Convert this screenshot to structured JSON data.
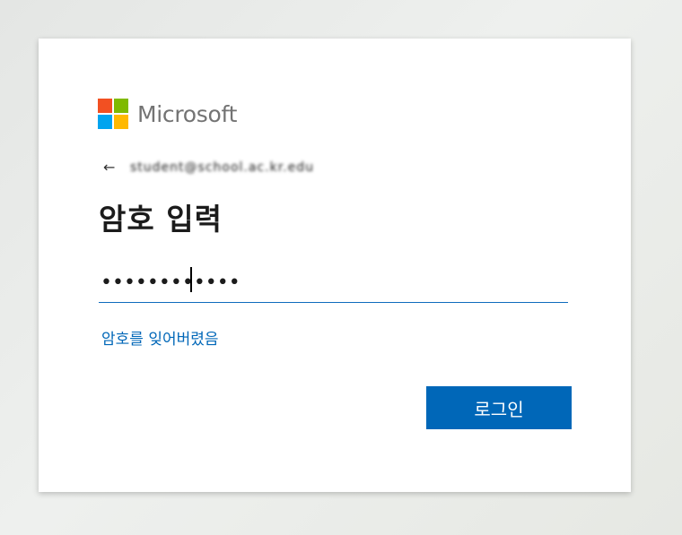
{
  "brand": {
    "name": "Microsoft",
    "logo_colors": {
      "top_left": "#f25022",
      "top_right": "#7fba00",
      "bottom_left": "#00a4ef",
      "bottom_right": "#ffb900"
    }
  },
  "identity": {
    "back_icon": "back-arrow-icon",
    "back_glyph": "←",
    "email": "student@school.ac.kr.edu"
  },
  "title": "암호 입력",
  "password": {
    "value": "••••••••••••"
  },
  "forgot_password_link": "암호를 잊어버렸음",
  "signin_button": {
    "label": "로그인",
    "color": "#0067b8"
  }
}
